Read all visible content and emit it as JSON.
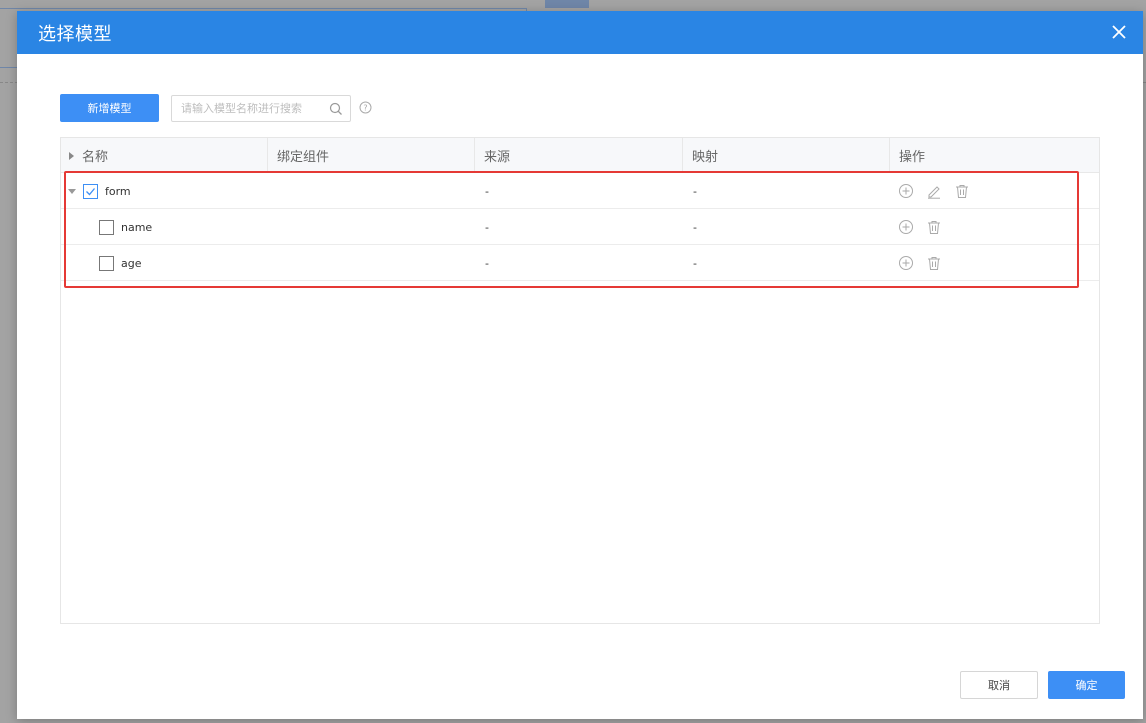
{
  "dialog": {
    "title": "选择模型"
  },
  "toolbar": {
    "add_label": "新增模型",
    "search_placeholder": "请输入模型名称进行搜索"
  },
  "table": {
    "columns": [
      "名称",
      "绑定组件",
      "来源",
      "映射",
      "操作"
    ],
    "rows": [
      {
        "name": "form",
        "component": "",
        "source": "-",
        "mapping": "-",
        "checked": true,
        "expanded": true,
        "level": 0,
        "actions": [
          "add-icon",
          "edit-icon",
          "delete-icon"
        ]
      },
      {
        "name": "name",
        "component": "",
        "source": "-",
        "mapping": "-",
        "checked": false,
        "level": 1,
        "actions": [
          "add-icon",
          "delete-icon"
        ]
      },
      {
        "name": "age",
        "component": "",
        "source": "-",
        "mapping": "-",
        "checked": false,
        "level": 1,
        "actions": [
          "add-icon",
          "delete-icon"
        ]
      }
    ]
  },
  "footer": {
    "cancel_label": "取消",
    "ok_label": "确定"
  },
  "colors": {
    "header_blue": "#2a85e4",
    "primary": "#3d8ff5",
    "highlight": "#e53935"
  }
}
